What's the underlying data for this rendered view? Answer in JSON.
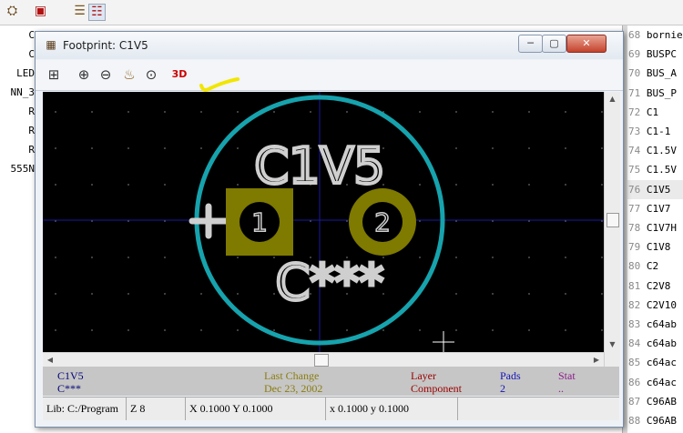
{
  "host": {
    "left_lines": [
      "C",
      "C",
      "LED",
      "NN_3",
      "R",
      "R",
      "R",
      "555N"
    ],
    "right_lines": [
      {
        "num": "68",
        "text": "bornier"
      },
      {
        "num": "69",
        "text": "BUSPC"
      },
      {
        "num": "70",
        "text": "BUS_A"
      },
      {
        "num": "71",
        "text": "BUS_P"
      },
      {
        "num": "72",
        "text": "C1"
      },
      {
        "num": "73",
        "text": "C1-1"
      },
      {
        "num": "74",
        "text": "C1.5V"
      },
      {
        "num": "75",
        "text": "C1.5V"
      },
      {
        "num": "76",
        "text": "C1V5"
      },
      {
        "num": "77",
        "text": "C1V7"
      },
      {
        "num": "78",
        "text": "C1V7H"
      },
      {
        "num": "79",
        "text": "C1V8"
      },
      {
        "num": "80",
        "text": "C2"
      },
      {
        "num": "81",
        "text": "C2V8"
      },
      {
        "num": "82",
        "text": "C2V10"
      },
      {
        "num": "83",
        "text": "c64ab"
      },
      {
        "num": "84",
        "text": "c64ab"
      },
      {
        "num": "85",
        "text": "c64ac"
      },
      {
        "num": "86",
        "text": "c64ac"
      },
      {
        "num": "87",
        "text": "C96AB"
      },
      {
        "num": "88",
        "text": "C96AB"
      }
    ]
  },
  "window": {
    "title": "Footprint: C1V5",
    "minimize_glyph": "─",
    "maximize_glyph": "▢",
    "close_glyph": "✕"
  },
  "toolbar": {
    "icons": [
      "display-options-icon",
      "zoom-in-icon",
      "zoom-out-icon",
      "redraw-icon",
      "zoom-fit-icon",
      "3d-view-icon"
    ],
    "label_3d": "3D"
  },
  "canvas": {
    "reference_text": "C1V5",
    "value_text": "C***",
    "pad1_number": "1",
    "pad2_number": "2",
    "colors": {
      "background": "#000000",
      "outline": "#16a3ad",
      "pad": "#7f7a00",
      "text": "#cfcfcf",
      "axis": "#1a1aa0"
    }
  },
  "info": {
    "name": "C1V5",
    "value": "C***",
    "last_change_label": "Last Change",
    "last_change_date": "Dec 23, 2002",
    "layer_label": "Layer",
    "layer_value": "Component",
    "pads_label": "Pads",
    "pads_value": "2",
    "stat_label": "Stat",
    "stat_value": ".."
  },
  "status": {
    "lib": "Lib: C:/Program",
    "zoom": "Z 8",
    "abs_coords": "X 0.1000  Y 0.1000",
    "rel_coords": "x 0.1000  y 0.1000"
  }
}
